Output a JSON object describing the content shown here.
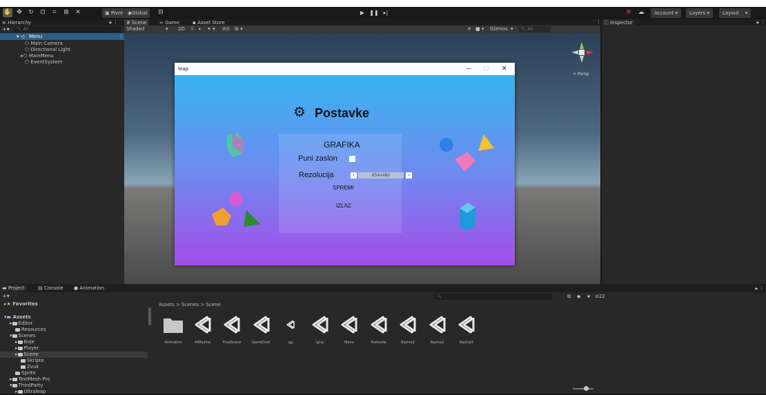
{
  "toolbar": {
    "pivot": "Pivot",
    "global": "Global",
    "account": "Account",
    "layers": "Layers",
    "layout": "Layout"
  },
  "hierarchy": {
    "tab": "Hierarchy",
    "search_placeholder": "All",
    "root": "Menu",
    "items": [
      "Main Camera",
      "Directional Light",
      "MainMenu",
      "EventSystem"
    ]
  },
  "scene": {
    "tabs": [
      "Scene",
      "Game",
      "Asset Store"
    ],
    "shading": "Shaded",
    "mode_2d": "2D",
    "gizmos": "Gizmos",
    "search_placeholder": "All",
    "persp": "< Persp"
  },
  "inspector": {
    "tab": "Inspector"
  },
  "game_window": {
    "title": "leap",
    "minimize": "—",
    "maximize": "☐",
    "close": "✕",
    "heading": "Postavke",
    "section": "GRAFIKA",
    "fullscreen_label": "Puni zaslon",
    "resolution_label": "Rezolucija",
    "resolution_value": "854x480",
    "save": "SPREMI",
    "exit": "IZLAZ"
  },
  "bottom": {
    "tabs": [
      "Project",
      "Console",
      "Animation"
    ],
    "favorites": "Favorites",
    "assets": "Assets",
    "tree": [
      "Editor",
      "Resources",
      "Scenes",
      "Boje",
      "Player",
      "Scene",
      "Skripte",
      "Zvuk",
      "Sprite",
      "TextMesh Pro",
      "ThirdParty",
      "Ultraleap"
    ],
    "breadcrumb": "Assets > Scenes > Scene",
    "zoom_count": "22",
    "files": [
      "Animation",
      "AllRazina",
      "FinalScene",
      "GameOver",
      "gg",
      "Igraj",
      "Menu",
      "Postavke",
      "Razina1",
      "Razina2",
      "Razina3"
    ]
  }
}
